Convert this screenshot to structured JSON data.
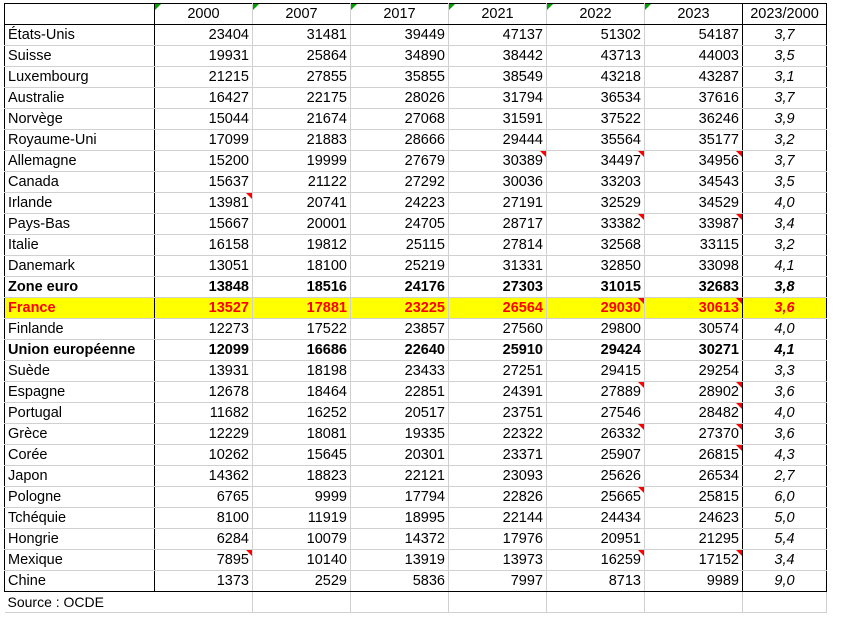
{
  "headers": [
    "",
    "2000",
    "2007",
    "2017",
    "2021",
    "2022",
    "2023",
    "2023/2000"
  ],
  "rows": [
    {
      "label": "États-Unis",
      "values": [
        "23404",
        "31481",
        "39449",
        "47137",
        "51302",
        "54187"
      ],
      "ratio": "3,7"
    },
    {
      "label": "Suisse",
      "values": [
        "19931",
        "25864",
        "34890",
        "38442",
        "43713",
        "44003"
      ],
      "ratio": "3,5"
    },
    {
      "label": "Luxembourg",
      "values": [
        "21215",
        "27855",
        "35855",
        "38549",
        "43218",
        "43287"
      ],
      "ratio": "3,1"
    },
    {
      "label": "Australie",
      "values": [
        "16427",
        "22175",
        "28026",
        "31794",
        "36534",
        "37616"
      ],
      "ratio": "3,7"
    },
    {
      "label": "Norvège",
      "values": [
        "15044",
        "21674",
        "27068",
        "31591",
        "37522",
        "36246"
      ],
      "ratio": "3,9"
    },
    {
      "label": "Royaume-Uni",
      "values": [
        "17099",
        "21883",
        "28666",
        "29444",
        "35564",
        "35177"
      ],
      "ratio": "3,2"
    },
    {
      "label": "Allemagne",
      "values": [
        "15200",
        "19999",
        "27679",
        "30389",
        "34497",
        "34956"
      ],
      "ratio": "3,7"
    },
    {
      "label": "Canada",
      "values": [
        "15637",
        "21122",
        "27292",
        "30036",
        "33203",
        "34543"
      ],
      "ratio": "3,5"
    },
    {
      "label": "Irlande",
      "values": [
        "13981",
        "20741",
        "24223",
        "27191",
        "32529",
        "34529"
      ],
      "ratio": "4,0"
    },
    {
      "label": "Pays-Bas",
      "values": [
        "15667",
        "20001",
        "24705",
        "28717",
        "33382",
        "33987"
      ],
      "ratio": "3,4"
    },
    {
      "label": "Italie",
      "values": [
        "16158",
        "19812",
        "25115",
        "27814",
        "32568",
        "33115"
      ],
      "ratio": "3,2"
    },
    {
      "label": "Danemark",
      "values": [
        "13051",
        "18100",
        "25219",
        "31331",
        "32850",
        "33098"
      ],
      "ratio": "4,1"
    },
    {
      "label": "Zone euro",
      "values": [
        "13848",
        "18516",
        "24176",
        "27303",
        "31015",
        "32683"
      ],
      "ratio": "3,8"
    },
    {
      "label": "France",
      "values": [
        "13527",
        "17881",
        "23225",
        "26564",
        "29030",
        "30613"
      ],
      "ratio": "3,6"
    },
    {
      "label": "Finlande",
      "values": [
        "12273",
        "17522",
        "23857",
        "27560",
        "29800",
        "30574"
      ],
      "ratio": "4,0"
    },
    {
      "label": "Union européenne",
      "values": [
        "12099",
        "16686",
        "22640",
        "25910",
        "29424",
        "30271"
      ],
      "ratio": "4,1"
    },
    {
      "label": "Suède",
      "values": [
        "13931",
        "18198",
        "23433",
        "27251",
        "29415",
        "29254"
      ],
      "ratio": "3,3"
    },
    {
      "label": "Espagne",
      "values": [
        "12678",
        "18464",
        "22851",
        "24391",
        "27889",
        "28902"
      ],
      "ratio": "3,6"
    },
    {
      "label": "Portugal",
      "values": [
        "11682",
        "16252",
        "20517",
        "23751",
        "27546",
        "28482"
      ],
      "ratio": "4,0"
    },
    {
      "label": "Grèce",
      "values": [
        "12229",
        "18081",
        "19335",
        "22322",
        "26332",
        "27370"
      ],
      "ratio": "3,6"
    },
    {
      "label": "Corée",
      "values": [
        "10262",
        "15645",
        "20301",
        "23371",
        "25907",
        "26815"
      ],
      "ratio": "4,3"
    },
    {
      "label": "Japon",
      "values": [
        "14362",
        "18823",
        "22121",
        "23093",
        "25626",
        "26534"
      ],
      "ratio": "2,7"
    },
    {
      "label": "Pologne",
      "values": [
        "6765",
        "9999",
        "17794",
        "22826",
        "25665",
        "25815"
      ],
      "ratio": "6,0"
    },
    {
      "label": "Tchéquie",
      "values": [
        "8100",
        "11919",
        "18995",
        "22144",
        "24434",
        "24623"
      ],
      "ratio": "5,0"
    },
    {
      "label": "Hongrie",
      "values": [
        "6284",
        "10079",
        "14372",
        "17976",
        "20951",
        "21295"
      ],
      "ratio": "5,4"
    },
    {
      "label": "Mexique",
      "values": [
        "7895",
        "10140",
        "13919",
        "13973",
        "16259",
        "17152"
      ],
      "ratio": "3,4"
    },
    {
      "label": "Chine",
      "values": [
        "1373",
        "2529",
        "5836",
        "7997",
        "8713",
        "9989"
      ],
      "ratio": "9,0"
    }
  ],
  "source": "Source : OCDE",
  "colors": {
    "highlight_bg": "#ffff00",
    "highlight_text": "#ff0000",
    "comment_mark": "#ff0000",
    "header_mark": "#00a000"
  }
}
